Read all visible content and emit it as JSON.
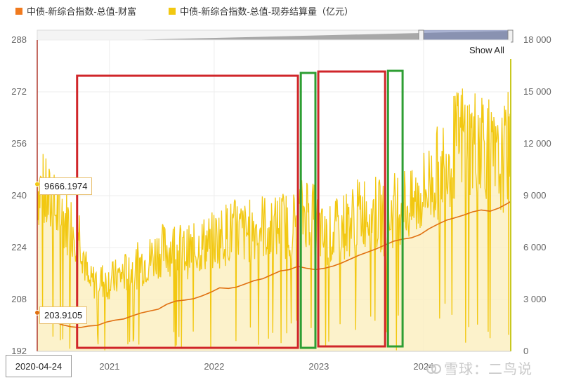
{
  "legend": [
    {
      "label": "中债-新综合指数-总值-财富",
      "color": "#f07a1e"
    },
    {
      "label": "中债-新综合指数-总值-现券结算量（亿元）",
      "color": "#f2c811"
    }
  ],
  "show_all_label": "Show All",
  "tooltip_volume": "9666.1974",
  "tooltip_index": "203.9105",
  "date_label": "2020-04-24",
  "watermark": "雪球：二鸟说",
  "chart_data": {
    "type": "line",
    "x_range": [
      "2020-04-24",
      "2024-10-31"
    ],
    "x_tick_labels": [
      "2021",
      "2022",
      "2023",
      "2024"
    ],
    "y_left": {
      "range": [
        192,
        288
      ],
      "ticks": [
        "192",
        "208",
        "224",
        "240",
        "256",
        "272",
        "288"
      ]
    },
    "y_right": {
      "range": [
        0,
        18000
      ],
      "ticks": [
        "0",
        "3 000",
        "6 000",
        "9 000",
        "12 000",
        "15 000",
        "18 000"
      ]
    },
    "series": [
      {
        "name": "中债-新综合指数-总值-财富",
        "axis": "left",
        "color": "#e07010",
        "points": [
          [
            "2020-04-24",
            203.9
          ],
          [
            "2020-05-20",
            202.8
          ],
          [
            "2020-06-20",
            201.2
          ],
          [
            "2020-07-20",
            200.2
          ],
          [
            "2020-08-20",
            199.6
          ],
          [
            "2020-09-20",
            199.3
          ],
          [
            "2020-10-20",
            199.8
          ],
          [
            "2020-11-20",
            200.0
          ],
          [
            "2020-12-20",
            201.0
          ],
          [
            "2021-01-20",
            201.6
          ],
          [
            "2021-02-20",
            202.0
          ],
          [
            "2021-03-20",
            202.9
          ],
          [
            "2021-04-20",
            203.8
          ],
          [
            "2021-05-20",
            204.4
          ],
          [
            "2021-06-20",
            205.0
          ],
          [
            "2021-07-20",
            206.5
          ],
          [
            "2021-08-20",
            207.5
          ],
          [
            "2021-09-20",
            207.8
          ],
          [
            "2021-10-20",
            208.2
          ],
          [
            "2021-11-20",
            209.1
          ],
          [
            "2021-12-20",
            210.2
          ],
          [
            "2022-01-20",
            211.6
          ],
          [
            "2022-02-20",
            211.4
          ],
          [
            "2022-03-20",
            211.8
          ],
          [
            "2022-04-20",
            212.8
          ],
          [
            "2022-05-20",
            213.8
          ],
          [
            "2022-06-20",
            214.4
          ],
          [
            "2022-07-20",
            215.6
          ],
          [
            "2022-08-20",
            216.8
          ],
          [
            "2022-09-20",
            217.2
          ],
          [
            "2022-10-20",
            218.2
          ],
          [
            "2022-11-20",
            217.6
          ],
          [
            "2022-12-20",
            217.2
          ],
          [
            "2023-01-20",
            217.6
          ],
          [
            "2023-02-20",
            218.3
          ],
          [
            "2023-03-20",
            219.2
          ],
          [
            "2023-04-20",
            220.4
          ],
          [
            "2023-05-20",
            221.6
          ],
          [
            "2023-06-20",
            222.6
          ],
          [
            "2023-07-20",
            223.6
          ],
          [
            "2023-08-20",
            224.8
          ],
          [
            "2023-09-20",
            226.0
          ],
          [
            "2023-10-20",
            226.6
          ],
          [
            "2023-11-20",
            227.0
          ],
          [
            "2023-12-20",
            228.0
          ],
          [
            "2024-01-20",
            229.8
          ],
          [
            "2024-02-20",
            231.2
          ],
          [
            "2024-03-20",
            232.4
          ],
          [
            "2024-04-20",
            233.2
          ],
          [
            "2024-05-20",
            234.0
          ],
          [
            "2024-06-20",
            235.0
          ],
          [
            "2024-07-20",
            235.6
          ],
          [
            "2024-08-20",
            235.2
          ],
          [
            "2024-09-20",
            236.2
          ],
          [
            "2024-10-20",
            237.6
          ],
          [
            "2024-10-31",
            238.2
          ]
        ]
      },
      {
        "name": "中债-新综合指数-总值-现券结算量（亿元）",
        "axis": "right",
        "color": "#f2c811",
        "points": [
          [
            "2020-04-24",
            9666
          ],
          [
            "2020-05-20",
            8900
          ],
          [
            "2020-06-20",
            8200
          ],
          [
            "2020-07-20",
            7800
          ],
          [
            "2020-08-20",
            7300
          ],
          [
            "2020-09-20",
            7000
          ],
          [
            "2020-10-20",
            3800
          ],
          [
            "2020-11-20",
            4200
          ],
          [
            "2020-12-20",
            4000
          ],
          [
            "2021-01-20",
            4200
          ],
          [
            "2021-02-20",
            4500
          ],
          [
            "2021-03-20",
            4700
          ],
          [
            "2021-04-20",
            5100
          ],
          [
            "2021-05-20",
            5300
          ],
          [
            "2021-06-20",
            5800
          ],
          [
            "2021-07-20",
            5900
          ],
          [
            "2021-08-20",
            6000
          ],
          [
            "2021-09-20",
            5700
          ],
          [
            "2021-10-20",
            5800
          ],
          [
            "2021-11-20",
            6200
          ],
          [
            "2021-12-20",
            6300
          ],
          [
            "2022-01-20",
            6600
          ],
          [
            "2022-02-20",
            6900
          ],
          [
            "2022-03-20",
            7000
          ],
          [
            "2022-04-20",
            6800
          ],
          [
            "2022-05-20",
            7100
          ],
          [
            "2022-06-20",
            7300
          ],
          [
            "2022-07-20",
            6900
          ],
          [
            "2022-08-20",
            7400
          ],
          [
            "2022-09-20",
            7200
          ],
          [
            "2022-10-20",
            7600
          ],
          [
            "2022-11-20",
            8300
          ],
          [
            "2022-12-20",
            7500
          ],
          [
            "2023-01-20",
            6400
          ],
          [
            "2023-02-20",
            6800
          ],
          [
            "2023-03-20",
            7200
          ],
          [
            "2023-04-20",
            7500
          ],
          [
            "2023-05-20",
            7900
          ],
          [
            "2023-06-20",
            8300
          ],
          [
            "2023-07-20",
            8000
          ],
          [
            "2023-08-20",
            7500
          ],
          [
            "2023-09-20",
            8200
          ],
          [
            "2023-10-20",
            8600
          ],
          [
            "2023-11-20",
            8200
          ],
          [
            "2023-12-20",
            9000
          ],
          [
            "2024-01-20",
            9600
          ],
          [
            "2024-02-20",
            10300
          ],
          [
            "2024-03-20",
            11200
          ],
          [
            "2024-04-20",
            11800
          ],
          [
            "2024-05-20",
            12500
          ],
          [
            "2024-06-20",
            11900
          ],
          [
            "2024-07-20",
            12800
          ],
          [
            "2024-08-20",
            11200
          ],
          [
            "2024-09-20",
            10500
          ],
          [
            "2024-10-20",
            11600
          ],
          [
            "2024-10-31",
            13000
          ]
        ]
      }
    ],
    "highlight_ranges": [
      {
        "color": "red",
        "start": "2020-09-10",
        "end": "2022-10-20"
      },
      {
        "color": "green",
        "start": "2022-10-30",
        "end": "2022-12-20"
      },
      {
        "color": "red",
        "start": "2022-12-30",
        "end": "2023-08-20"
      },
      {
        "color": "green",
        "start": "2023-08-30",
        "end": "2023-10-20"
      }
    ],
    "tooltip_markers": [
      {
        "date": "2020-04-24",
        "axis": "right",
        "value": 9666.1974
      },
      {
        "date": "2020-04-24",
        "axis": "left",
        "value": 203.9105
      }
    ],
    "grid": true
  }
}
